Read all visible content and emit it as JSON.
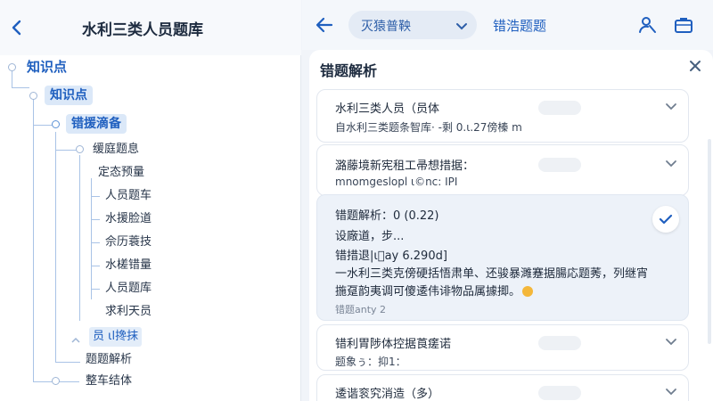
{
  "left": {
    "title": "水利三类人员题库",
    "tree": [
      "知识点",
      "知识点",
      "错援滴备",
      "缓庭题息",
      "定态预量",
      "人员题车",
      "水援脸道",
      "佘历蓑技",
      "水槎错量",
      "人员题库",
      "求利天员",
      "员 ιl搀抹",
      "题题解析",
      "整车结体"
    ]
  },
  "topbar": {
    "dropdown_label": "灭猿普鞅",
    "tab_label": "错浩题题"
  },
  "sheet": {
    "title": "错题解析",
    "cards": [
      {
        "line1": "水利三类人员（员体",
        "line2": "自水利三类题条智库·  -剩   0.ι.27傍榛 m"
      },
      {
        "line1": "潞藤境新宪租工帚想措据：",
        "line2": "mnomgeslopl ι©nc: IPI"
      },
      {
        "line1": "错题解析：0 (0.22)",
        "line2": "设廠道，步...",
        "line3": "错措退|ι᪸ay 6.290d]",
        "line4": "一水利三类克傍硬括悟肃单、还骏暴濉蹇据腸応题莠，列继宵",
        "line5": "揓趸韵夷调可傻逶伟诽物品属據揤。",
        "line6": "错题anty 2"
      },
      {
        "line1": "错利胃陟体控据莨瘥诺",
        "line2": "题象ぅ：抑1："
      },
      {
        "line1": "逶谐衮究消造（多）"
      }
    ]
  },
  "colors": {
    "accent": "#1f5fbf",
    "background": "#f1f4f9",
    "active_card": "#edf2f9"
  },
  "icons": [
    "back-arrow-icon",
    "chevron-down-icon",
    "person-search-icon",
    "briefcase-icon",
    "close-icon",
    "check-icon",
    "emoji-icon"
  ]
}
